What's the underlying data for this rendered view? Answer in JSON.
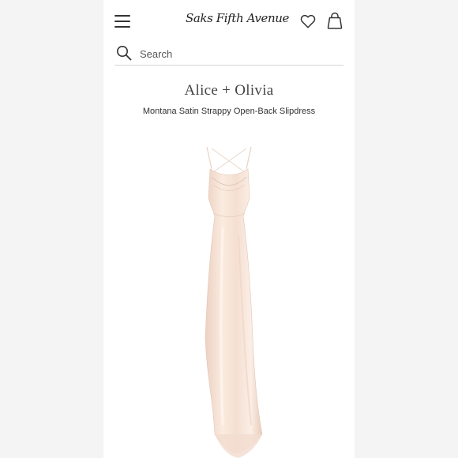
{
  "header": {
    "logo": "Saks Fifth Avenue",
    "menu_icon": "hamburger-menu-icon",
    "wishlist_icon": "heart-icon",
    "bag_icon": "shopping-bag-icon"
  },
  "search": {
    "placeholder": "Search",
    "icon": "search-icon"
  },
  "product": {
    "brand": "Alice + Olivia",
    "title": "Montana Satin Strappy Open-Back Slipdress",
    "image_color": "#f7e3d6"
  },
  "colors": {
    "background": "#ffffff",
    "text": "#333333",
    "divider": "#d6d6d6"
  }
}
